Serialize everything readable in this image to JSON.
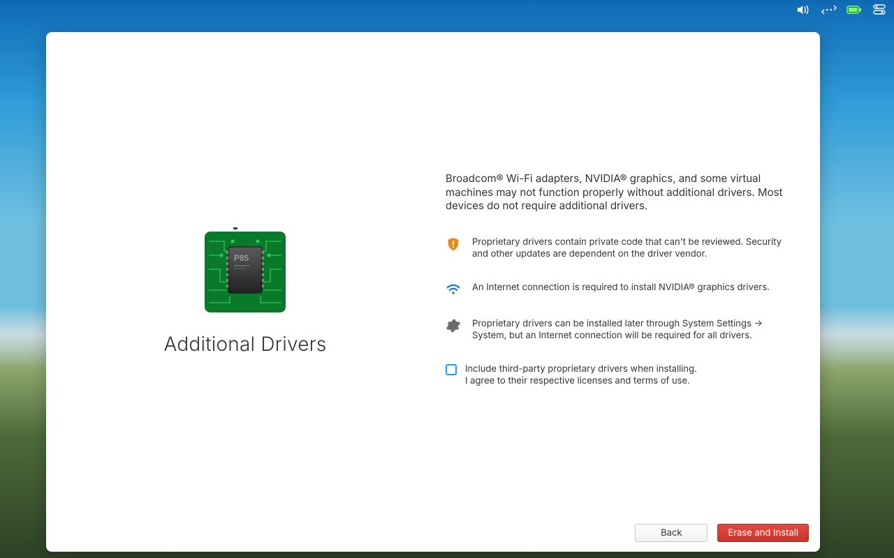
{
  "page": {
    "title": "Additional Drivers",
    "intro": "Broadcom® Wi-Fi adapters, NVIDIA® graphics, and some virtual machines may not function properly without additional drivers. Most devices do not require additional drivers."
  },
  "points": [
    {
      "icon": "shield-warning-icon",
      "text": "Proprietary drivers contain private code that can't be reviewed. Security and other updates are dependent on the driver vendor."
    },
    {
      "icon": "wifi-icon",
      "text": "An Internet connection is required to install NVIDIA® graphics drivers."
    },
    {
      "icon": "gear-icon",
      "text": "Proprietary drivers can be installed later through System Settings → System, but an Internet connection will be required for all drivers."
    }
  ],
  "consent": {
    "line1": "Include third-party proprietary drivers when installing.",
    "line2": "I agree to their respective licenses and terms of use.",
    "checked": false
  },
  "buttons": {
    "back": "Back",
    "primary": "Erase and Install"
  },
  "hero_chip_label": "P85",
  "tray": {
    "volume": "volume-icon",
    "network": "network-icon",
    "battery": "battery-icon",
    "a11y": "accessibility-icon"
  }
}
